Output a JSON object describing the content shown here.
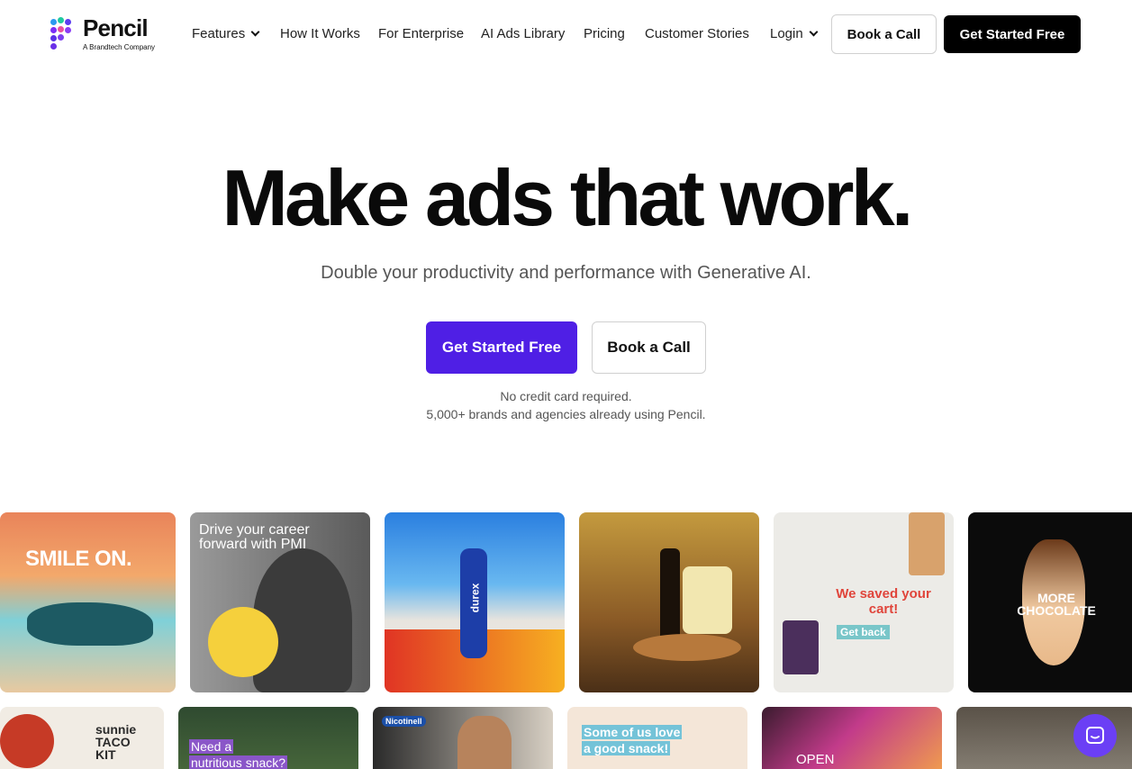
{
  "brand": {
    "name": "Pencil",
    "tagline": "A Brandtech Company"
  },
  "nav": {
    "features": "Features",
    "how_it_works": "How It Works",
    "for_enterprise": "For Enterprise",
    "ai_ads_library": "AI Ads Library",
    "pricing": "Pricing",
    "customer_stories": "Customer Stories",
    "login": "Login",
    "book_call": "Book a Call",
    "get_started": "Get Started Free"
  },
  "hero": {
    "title": "Make ads that work.",
    "subtitle": "Double your productivity and performance with Generative AI.",
    "cta_primary": "Get Started Free",
    "cta_secondary": "Book a Call",
    "note_1": "No credit card required.",
    "note_2": "5,000+ brands and agencies already using Pencil."
  },
  "gallery": {
    "card_1_text": "SMILE ON.",
    "card_2_text": "Drive your career forward with PMI",
    "card_3_text": "durex",
    "card_5_text_1": "We saved your cart!",
    "card_5_text_2": "Get back",
    "card_6_text": "MORE CHOCOLATE",
    "card_7_text": "sunnie TACO KIT",
    "card_8_text_1": "Need a",
    "card_8_text_2": "nutritious snack?",
    "card_9_text": "Nicotinell",
    "card_10_text_1": "Some of us love",
    "card_10_text_2": "a good snack!",
    "card_11_text": "OPEN"
  },
  "colors": {
    "accent": "#4f1fe5",
    "black": "#000000",
    "chat": "#6b3ff5"
  },
  "icons": {
    "chat": "chat-bubble-icon",
    "chevron": "chevron-down-icon"
  }
}
